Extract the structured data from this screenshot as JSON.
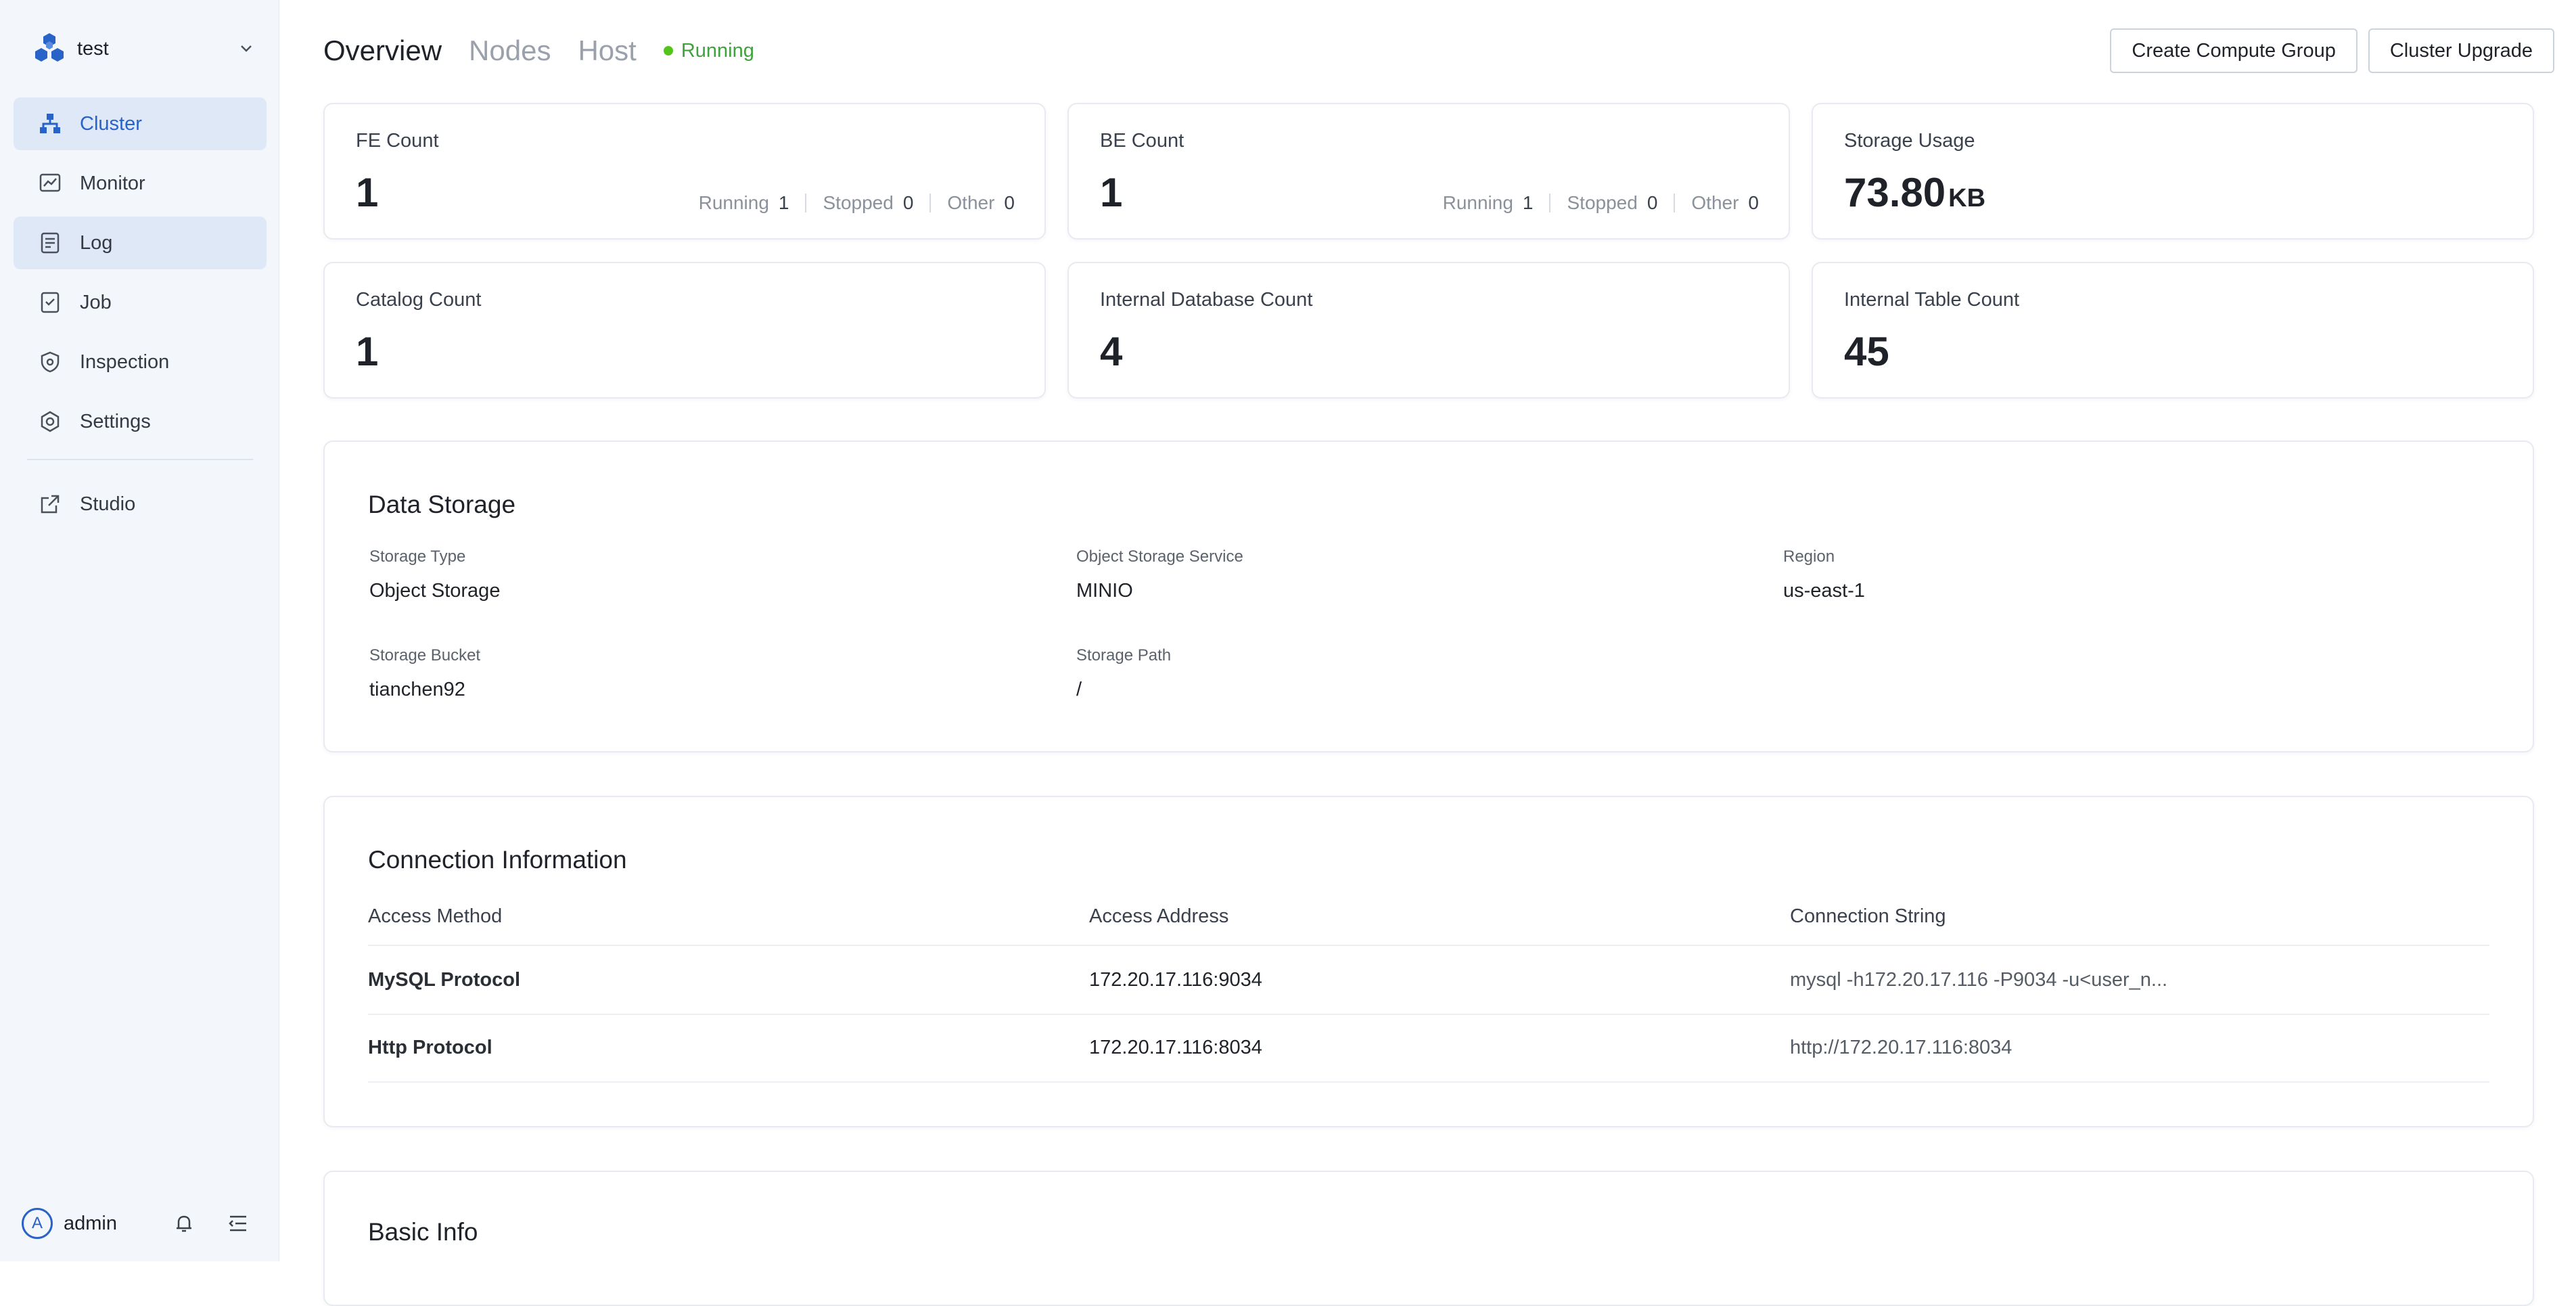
{
  "sidebar": {
    "cluster_name": "test",
    "items": [
      {
        "label": "Cluster",
        "icon": "cluster-icon",
        "active": true
      },
      {
        "label": "Monitor",
        "icon": "monitor-icon"
      },
      {
        "label": "Log",
        "icon": "log-icon"
      },
      {
        "label": "Job",
        "icon": "job-icon"
      },
      {
        "label": "Inspection",
        "icon": "inspection-icon"
      },
      {
        "label": "Settings",
        "icon": "gear-icon"
      }
    ],
    "studio_label": "Studio",
    "user": {
      "avatar_letter": "A",
      "name": "admin"
    }
  },
  "header": {
    "tabs": [
      "Overview",
      "Nodes",
      "Host"
    ],
    "status": "Running",
    "actions": {
      "create_compute_group": "Create Compute Group",
      "cluster_upgrade": "Cluster Upgrade"
    }
  },
  "stats": {
    "fe": {
      "label": "FE Count",
      "value": "1",
      "running_label": "Running",
      "running": "1",
      "stopped_label": "Stopped",
      "stopped": "0",
      "other_label": "Other",
      "other": "0"
    },
    "be": {
      "label": "BE Count",
      "value": "1",
      "running_label": "Running",
      "running": "1",
      "stopped_label": "Stopped",
      "stopped": "0",
      "other_label": "Other",
      "other": "0"
    },
    "storage": {
      "label": "Storage Usage",
      "value": "73.80",
      "unit": "KB"
    },
    "catalog": {
      "label": "Catalog Count",
      "value": "1"
    },
    "database": {
      "label": "Internal Database Count",
      "value": "4"
    },
    "table": {
      "label": "Internal Table Count",
      "value": "45"
    }
  },
  "data_storage": {
    "title": "Data Storage",
    "storage_type": {
      "label": "Storage Type",
      "value": "Object Storage"
    },
    "service": {
      "label": "Object Storage Service",
      "value": "MINIO"
    },
    "region": {
      "label": "Region",
      "value": "us-east-1"
    },
    "bucket": {
      "label": "Storage Bucket",
      "value": "tianchen92"
    },
    "path": {
      "label": "Storage Path",
      "value": "/"
    }
  },
  "connection": {
    "title": "Connection Information",
    "headers": {
      "method": "Access Method",
      "address": "Access Address",
      "string": "Connection String"
    },
    "rows": [
      {
        "method": "MySQL Protocol",
        "address": "172.20.17.116:9034",
        "string": "mysql -h172.20.17.116 -P9034 -u<user_n..."
      },
      {
        "method": "Http Protocol",
        "address": "172.20.17.116:8034",
        "string": "http://172.20.17.116:8034"
      }
    ]
  },
  "basic_info": {
    "title": "Basic Info"
  },
  "colors": {
    "accent": "#2a63c8",
    "running": "#52c41a",
    "sidebar_bg": "#f3f6fb"
  }
}
